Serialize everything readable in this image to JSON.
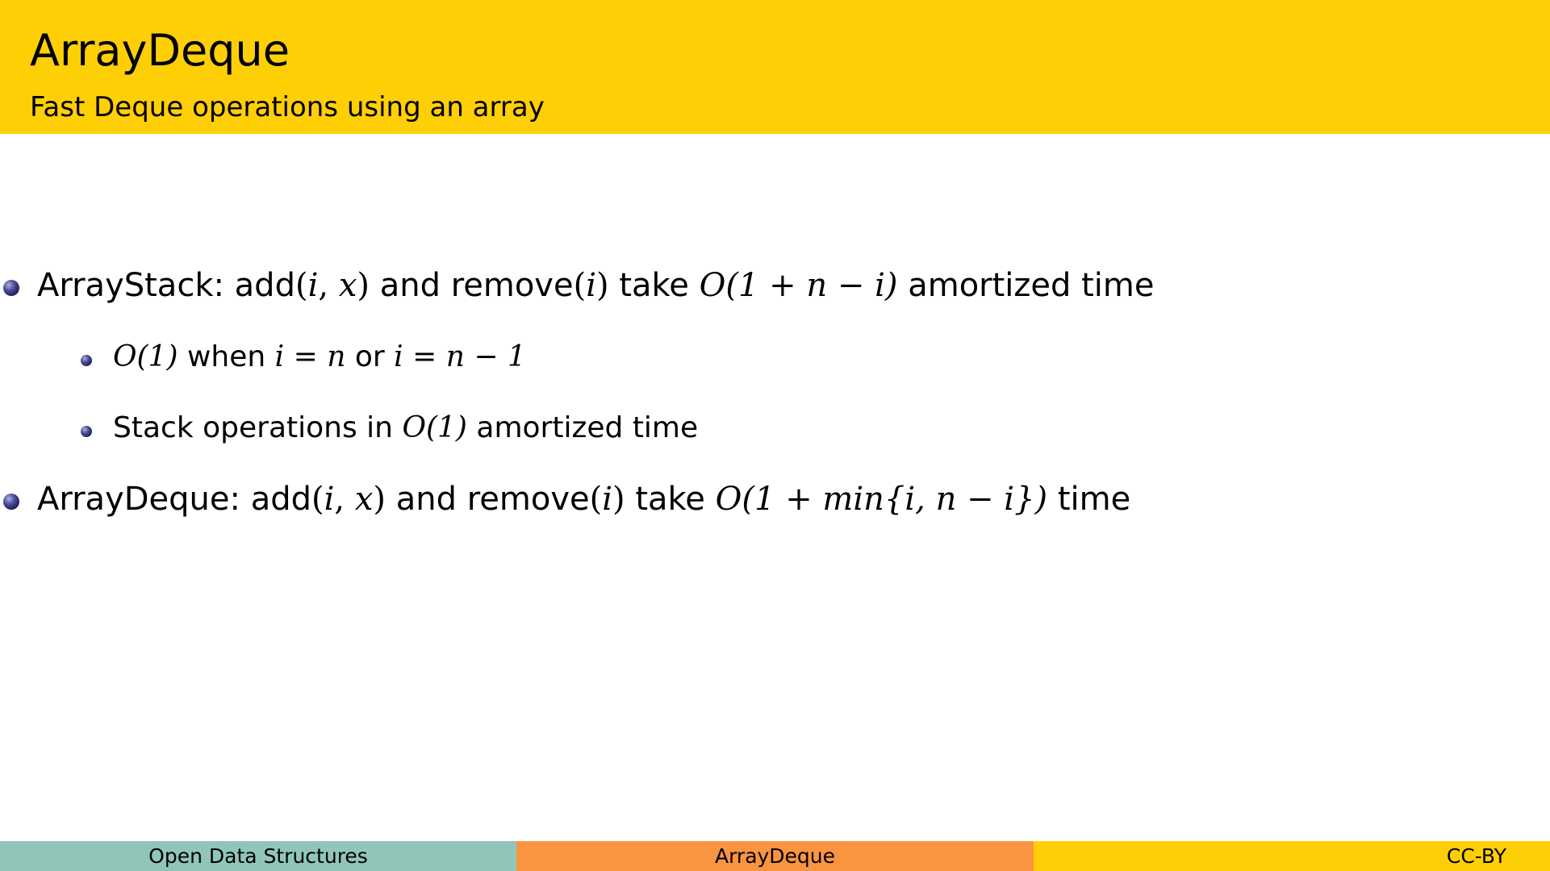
{
  "slide": {
    "title": "ArrayDeque",
    "subtitle": "Fast Deque operations using an array"
  },
  "bullets": [
    {
      "label": "ArrayStack:",
      "method_add": "add",
      "args_add": [
        "i",
        "x"
      ],
      "conj": "and",
      "method_remove": "remove",
      "arg_remove": "i",
      "take": "take",
      "complexity": "O(1 + n − i)",
      "suffix": "amortized time",
      "sub": [
        {
          "text_complexity": "O(1)",
          "text_when": "when",
          "cond1": "i = n",
          "text_or": "or",
          "cond2": "i = n − 1"
        },
        {
          "prefix": "Stack operations in",
          "complexity": "O(1)",
          "suffix": "amortized time"
        }
      ]
    },
    {
      "label": "ArrayDeque:",
      "method_add": "add",
      "args_add": [
        "i",
        "x"
      ],
      "conj": "and",
      "method_remove": "remove",
      "arg_remove": "i",
      "take": "take",
      "complexity": "O(1 + min{i, n − i})",
      "suffix": "time"
    }
  ],
  "footer": {
    "left": "Open Data Structures",
    "center": "ArrayDeque",
    "right": "CC-BY"
  },
  "colors": {
    "header": "#ffcf06",
    "footer_left": "#8fc6b9",
    "footer_center": "#f99441",
    "footer_right": "#ffcf06",
    "bullet": "#2a2b72"
  }
}
